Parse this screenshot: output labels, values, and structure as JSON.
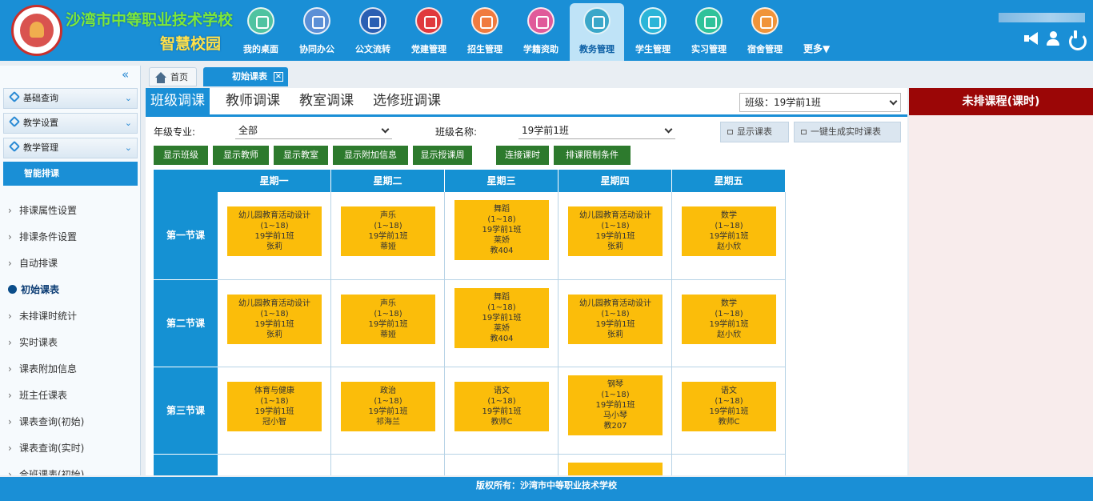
{
  "header": {
    "school_name": "沙湾市中等职业技术学校",
    "campus_name": "智慧校园",
    "nav_items": [
      {
        "label": "我的桌面",
        "icon": "desktop-icon",
        "color": "#4fc3a1"
      },
      {
        "label": "协同办公",
        "icon": "office-icon",
        "color": "#5b8fd6"
      },
      {
        "label": "公文流转",
        "icon": "document-flow-icon",
        "color": "#2b5fb3"
      },
      {
        "label": "党建管理",
        "icon": "flag-icon",
        "color": "#e0393e"
      },
      {
        "label": "招生管理",
        "icon": "enrollment-icon",
        "color": "#f07b3f"
      },
      {
        "label": "学籍资助",
        "icon": "student-aid-icon",
        "color": "#e05a9a"
      },
      {
        "label": "教务管理",
        "icon": "academic-icon",
        "color": "#3aa7c9"
      },
      {
        "label": "学生管理",
        "icon": "student-icon",
        "color": "#2bb5d8"
      },
      {
        "label": "实习管理",
        "icon": "internship-icon",
        "color": "#2fc29a"
      },
      {
        "label": "宿舍管理",
        "icon": "dormitory-icon",
        "color": "#f0943a"
      }
    ],
    "more_label": "更多▼"
  },
  "sidebar": {
    "groups": [
      {
        "label": "基础查询"
      },
      {
        "label": "教学设置"
      },
      {
        "label": "教学管理"
      }
    ],
    "active_category": "智能排课",
    "links": [
      {
        "label": "排课属性设置"
      },
      {
        "label": "排课条件设置"
      },
      {
        "label": "自动排课"
      },
      {
        "label": "初始课表"
      },
      {
        "label": "未排课时统计"
      },
      {
        "label": "实时课表"
      },
      {
        "label": "课表附加信息"
      },
      {
        "label": "班主任课表"
      },
      {
        "label": "课表查询(初始)"
      },
      {
        "label": "课表查询(实时)"
      },
      {
        "label": "合班课表(初始)"
      }
    ]
  },
  "tabs": {
    "home": "首页",
    "current": "初始课表"
  },
  "main": {
    "subtabs": [
      "班级调课",
      "教师调课",
      "教室调课",
      "选修班调课"
    ],
    "class_select": "班级：19学前1班",
    "grade_label": "年级专业:",
    "grade_value": "全部",
    "class_name_label": "班级名称:",
    "class_name_value": "19学前1班",
    "right_buttons": [
      "显示课表",
      "一键生成实时课表"
    ],
    "action_buttons": [
      "显示班级",
      "显示教师",
      "显示教室",
      "显示附加信息",
      "显示授课周",
      "连接课时",
      "排课限制条件"
    ],
    "days": [
      "星期一",
      "星期二",
      "星期三",
      "星期四",
      "星期五"
    ],
    "periods": [
      {
        "label": "第一节课",
        "cells": [
          [
            "幼儿园教育活动设计",
            "(1~18)",
            "19学前1班",
            "张莉"
          ],
          [
            "声乐",
            "(1~18)",
            "19学前1班",
            "蒂娅"
          ],
          [
            "舞蹈",
            "(1~18)",
            "19学前1班",
            "莱娇",
            "教404"
          ],
          [
            "幼儿园教育活动设计",
            "(1~18)",
            "19学前1班",
            "张莉"
          ],
          [
            "数学",
            "(1~18)",
            "19学前1班",
            "赵小欣"
          ]
        ]
      },
      {
        "label": "第二节课",
        "cells": [
          [
            "幼儿园教育活动设计",
            "(1~18)",
            "19学前1班",
            "张莉"
          ],
          [
            "声乐",
            "(1~18)",
            "19学前1班",
            "蒂娅"
          ],
          [
            "舞蹈",
            "(1~18)",
            "19学前1班",
            "莱娇",
            "教404"
          ],
          [
            "幼儿园教育活动设计",
            "(1~18)",
            "19学前1班",
            "张莉"
          ],
          [
            "数学",
            "(1~18)",
            "19学前1班",
            "赵小欣"
          ]
        ]
      },
      {
        "label": "第三节课",
        "cells": [
          [
            "体育与健康",
            "(1~18)",
            "19学前1班",
            "冠小智"
          ],
          [
            "政治",
            "(1~18)",
            "19学前1班",
            "祁海兰"
          ],
          [
            "语文",
            "(1~18)",
            "19学前1班",
            "教师C"
          ],
          [
            "钢琴",
            "(1~18)",
            "19学前1班",
            "马小琴",
            "教207"
          ],
          [
            "语文",
            "(1~18)",
            "19学前1班",
            "教师C"
          ]
        ]
      }
    ]
  },
  "unscheduled": {
    "title": "未排课程(课时)"
  },
  "footer": {
    "text": "版权所有：沙湾市中等职业技术学校"
  }
}
